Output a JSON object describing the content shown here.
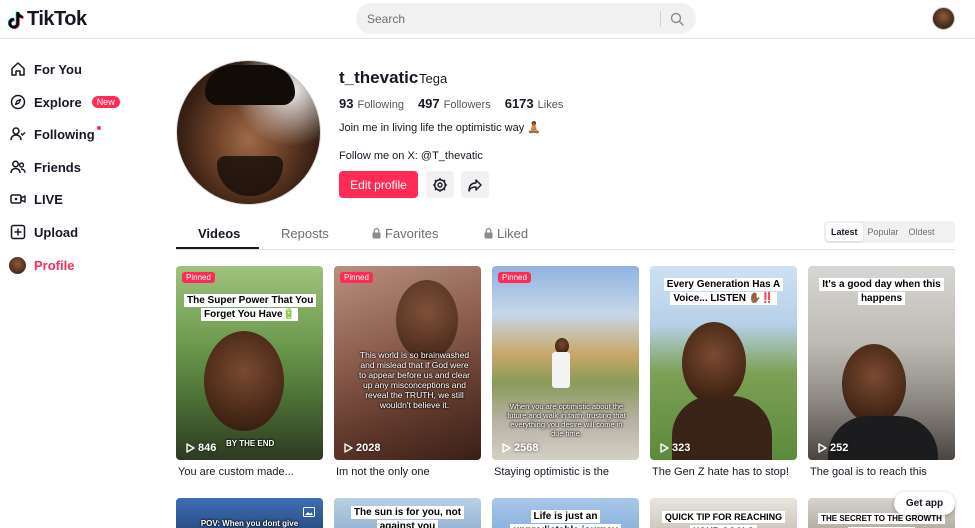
{
  "app": {
    "name": "TikTok"
  },
  "search": {
    "placeholder": "Search"
  },
  "sidebar": {
    "items": [
      {
        "label": "For You",
        "icon": "home-icon"
      },
      {
        "label": "Explore",
        "icon": "compass-icon",
        "badge": "New"
      },
      {
        "label": "Following",
        "icon": "following-icon"
      },
      {
        "label": "Friends",
        "icon": "friends-icon"
      },
      {
        "label": "LIVE",
        "icon": "live-icon"
      },
      {
        "label": "Upload",
        "icon": "upload-icon"
      },
      {
        "label": "Profile",
        "icon": "avatar"
      }
    ]
  },
  "profile": {
    "username": "t_thevatic",
    "nickname": "Tega",
    "following_count": "93",
    "following_label": "Following",
    "followers_count": "497",
    "followers_label": "Followers",
    "likes_count": "6173",
    "likes_label": "Likes",
    "bio_line1": "Join me in living life the optimistic way 🧘🏾",
    "bio_line2": "Follow me on X: @T_thevatic",
    "edit_label": "Edit profile"
  },
  "tabs": [
    {
      "label": "Videos"
    },
    {
      "label": "Reposts"
    },
    {
      "label": "Favorites"
    },
    {
      "label": "Liked"
    }
  ],
  "sort": {
    "latest": "Latest",
    "popular": "Popular",
    "oldest": "Oldest"
  },
  "videos": [
    {
      "pinned": "Pinned",
      "views": "846",
      "caption": "You are custom made...",
      "overlay": "The Super Power That You Forget You Have🔋",
      "sub": "BY THE END"
    },
    {
      "pinned": "Pinned",
      "views": "2028",
      "caption": "Im not the only one",
      "overlay": "This world is so brainwashed and mislead that if God were to appear before us and clear up any misconceptions and reveal the TRUTH, we still wouldn't believe it."
    },
    {
      "pinned": "Pinned",
      "views": "2568",
      "caption": "Staying optimistic is the",
      "overlay": "When you are optimistic about the future and walk in faith, trusting that everything you desire will come in due time."
    },
    {
      "views": "323",
      "caption": "The Gen Z hate has to stop!",
      "overlay": "Every Generation Has A Voice... LISTEN ✋🏾‼️"
    },
    {
      "views": "252",
      "caption": "The goal is to reach this",
      "overlay": "It's a good day when this happens"
    }
  ],
  "row2": [
    {
      "overlay": "POV: When you dont give"
    },
    {
      "overlay": "The sun is for you, not against you"
    },
    {
      "overlay": "Life is just an unpredictable journey"
    },
    {
      "overlay": "QUICK TIP FOR REACHING YOUR GOALS"
    },
    {
      "overlay": "THE SECRET TO THE GROWTH YOU DESIRE 🙌"
    }
  ],
  "get_app": "Get app",
  "colors": {
    "accent": "#fe2c55",
    "text": "#161823"
  }
}
